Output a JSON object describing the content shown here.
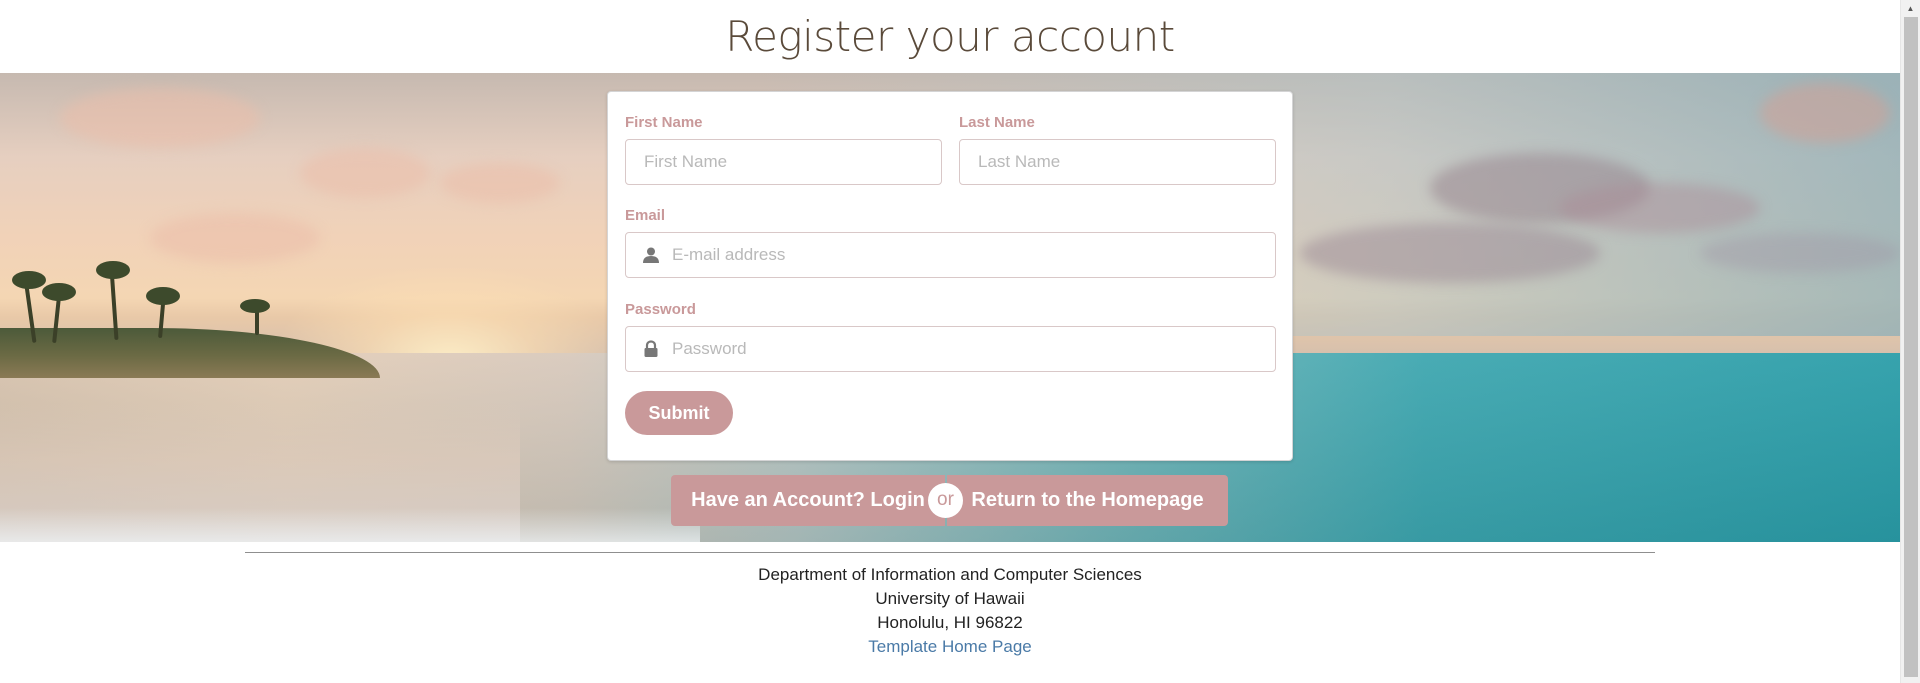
{
  "page": {
    "title": "Register your account"
  },
  "form": {
    "first_name": {
      "label": "First Name",
      "placeholder": "First Name"
    },
    "last_name": {
      "label": "Last Name",
      "placeholder": "Last Name"
    },
    "email": {
      "label": "Email",
      "placeholder": "E-mail address",
      "icon": "user-icon"
    },
    "password": {
      "label": "Password",
      "placeholder": "Password",
      "icon": "lock-icon"
    },
    "submit_label": "Submit"
  },
  "actions": {
    "login_label": "Have an Account? Login",
    "or_label": "or",
    "home_label": "Return to the Homepage"
  },
  "footer": {
    "line1": "Department of Information and Computer Sciences",
    "line2": "University of Hawaii",
    "line3": "Honolulu, HI 96822",
    "link_label": "Template Home Page"
  },
  "colors": {
    "accent": "#c9999a",
    "title": "#5a4a3a",
    "link": "#4a7aa7"
  }
}
